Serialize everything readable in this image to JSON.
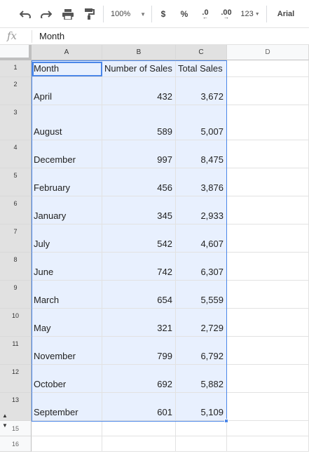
{
  "toolbar": {
    "zoom": "100%",
    "currency": "$",
    "percent": "%",
    "dec_decrease": ".0",
    "dec_increase": ".00",
    "more_formats": "123",
    "font": "Arial"
  },
  "formula_bar": {
    "fx": "fx",
    "value": "Month"
  },
  "columns": [
    "A",
    "B",
    "C",
    "D"
  ],
  "rows": [
    {
      "num": "1",
      "month": "Month",
      "sales": "Number of Sales",
      "total": "Total Sales"
    },
    {
      "num": "2",
      "month": "April",
      "sales": "432",
      "total": "3,672"
    },
    {
      "num": "3",
      "month": "August",
      "sales": "589",
      "total": "5,007"
    },
    {
      "num": "4",
      "month": "December",
      "sales": "997",
      "total": "8,475"
    },
    {
      "num": "5",
      "month": "February",
      "sales": "456",
      "total": "3,876"
    },
    {
      "num": "6",
      "month": "January",
      "sales": "345",
      "total": "2,933"
    },
    {
      "num": "7",
      "month": "July",
      "sales": "542",
      "total": "4,607"
    },
    {
      "num": "8",
      "month": "June",
      "sales": "742",
      "total": "6,307"
    },
    {
      "num": "9",
      "month": "March",
      "sales": "654",
      "total": "5,559"
    },
    {
      "num": "10",
      "month": "May",
      "sales": "321",
      "total": "2,729"
    },
    {
      "num": "11",
      "month": "November",
      "sales": "799",
      "total": "6,792"
    },
    {
      "num": "12",
      "month": "October",
      "sales": "692",
      "total": "5,882"
    },
    {
      "num": "13",
      "month": "September",
      "sales": "601",
      "total": "5,109"
    }
  ],
  "extra_rows": [
    "15",
    "16"
  ],
  "colors": {
    "selection_fill": "#e8f0fe",
    "selection_border": "#4a86e8",
    "header_bg": "#f8f9fa"
  }
}
